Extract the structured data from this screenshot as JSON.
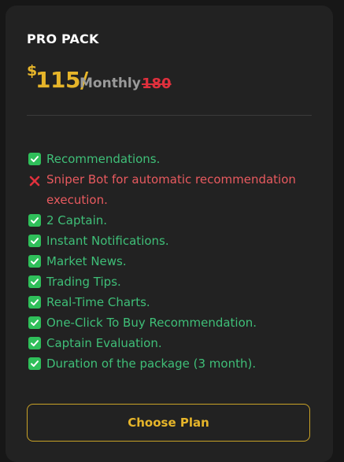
{
  "plan": {
    "title": "PRO PACK",
    "currency": "$",
    "price": "115/",
    "period": "Monthly",
    "old_price": "180"
  },
  "features": [
    {
      "text": "Recommendations.",
      "included": true,
      "icon": "check-icon"
    },
    {
      "text": "Sniper Bot for automatic recommendation execution.",
      "included": false,
      "icon": "cross-icon"
    },
    {
      "text": "2 Captain.",
      "included": true,
      "icon": "check-icon"
    },
    {
      "text": "Instant Notifications.",
      "included": true,
      "icon": "check-icon"
    },
    {
      "text": "Market News.",
      "included": true,
      "icon": "check-icon"
    },
    {
      "text": "Trading Tips.",
      "included": true,
      "icon": "check-icon"
    },
    {
      "text": "Real-Time Charts.",
      "included": true,
      "icon": "check-icon"
    },
    {
      "text": "One-Click To Buy Recommendation.",
      "included": true,
      "icon": "check-icon"
    },
    {
      "text": "Captain Evaluation.",
      "included": true,
      "icon": "check-icon"
    },
    {
      "text": "Duration of the package (3 month).",
      "included": true,
      "icon": "check-icon"
    }
  ],
  "cta": {
    "label": "Choose Plan"
  },
  "colors": {
    "page_bg": "#171717",
    "card_bg": "#222222",
    "accent_gold": "#e6b52a",
    "included_green": "#3fbf78",
    "excluded_red": "#e85a5f",
    "strike_red": "#e0303d"
  }
}
